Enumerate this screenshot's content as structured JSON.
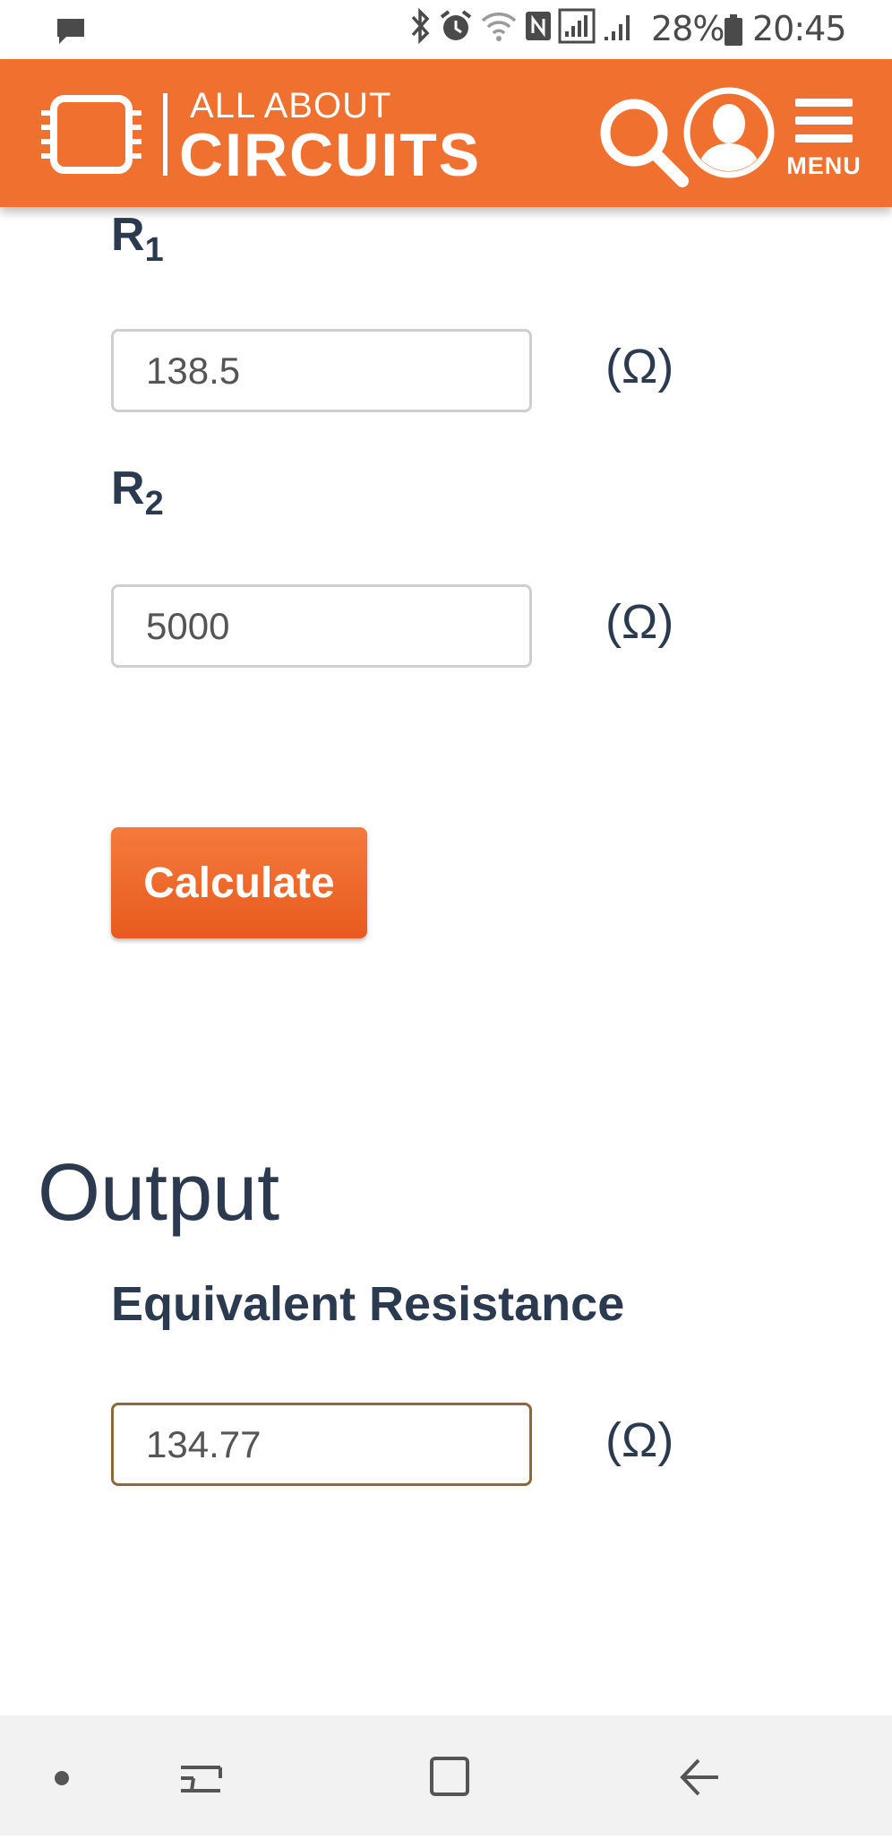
{
  "status_bar": {
    "battery_percent": "28%",
    "time": "20:45",
    "icons": [
      "message-icon",
      "bluetooth-icon",
      "alarm-icon",
      "wifi-icon",
      "nfc-icon",
      "signal-icon",
      "signal-icon",
      "battery-icon"
    ]
  },
  "header": {
    "logo_line1": "ALL ABOUT",
    "logo_line2": "CIRCUITS",
    "menu_label": "MENU",
    "brand_color": "#f07030"
  },
  "form": {
    "r1": {
      "label_main": "R",
      "label_sub": "1",
      "value": "138.5",
      "unit": "(Ω)"
    },
    "r2": {
      "label_main": "R",
      "label_sub": "2",
      "value": "5000",
      "unit": "(Ω)"
    },
    "calculate_label": "Calculate"
  },
  "output": {
    "title": "Output",
    "equivalent_label": "Equivalent Resistance",
    "value": "134.77",
    "unit": "(Ω)"
  },
  "nav_bar": {
    "icons": [
      "dot-icon",
      "recent-apps-icon",
      "home-icon",
      "back-icon"
    ]
  }
}
